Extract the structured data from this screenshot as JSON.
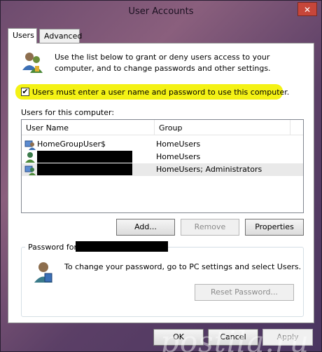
{
  "window": {
    "title": "User Accounts",
    "close_glyph": "✕"
  },
  "tabs": [
    {
      "label": "Users"
    },
    {
      "label": "Advanced"
    }
  ],
  "intro": {
    "text": "Use the list below to grant or deny users access to your computer, and to change passwords and other settings."
  },
  "require_login": {
    "checked": true,
    "check_glyph": "✔",
    "label": "Users must enter a user name and password to use this computer."
  },
  "users_section": {
    "label": "Users for this computer:"
  },
  "users_table": {
    "columns": [
      "User Name",
      "Group"
    ],
    "rows": [
      {
        "name": "HomeGroupUser$",
        "group": "HomeUsers"
      },
      {
        "name": "",
        "group": "HomeUsers"
      },
      {
        "name": "",
        "group": "HomeUsers; Administrators"
      }
    ]
  },
  "user_buttons": {
    "add": "Add...",
    "remove": "Remove",
    "properties": "Properties"
  },
  "password": {
    "legend": "Password for",
    "text": "To change your password, go to PC settings and select Users.",
    "reset": "Reset Password..."
  },
  "dialog_buttons": {
    "ok": "OK",
    "cancel": "Cancel",
    "apply": "Apply"
  },
  "watermark": "postila.ru"
}
